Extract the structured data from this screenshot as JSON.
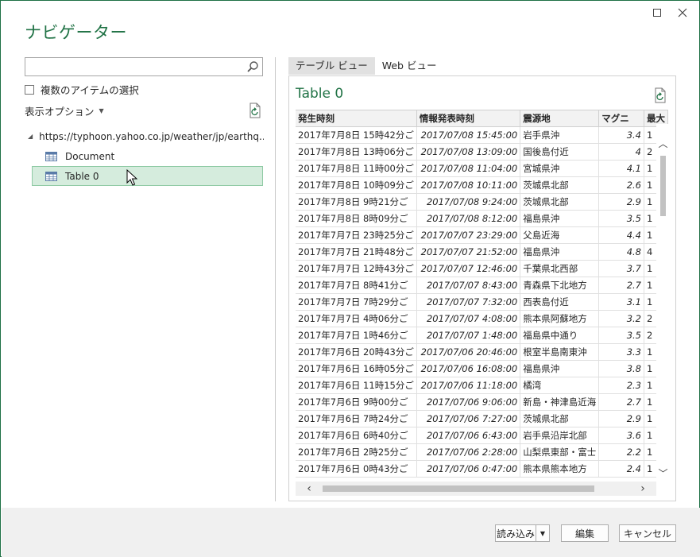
{
  "window": {
    "title": "ナビゲーター",
    "controls": [
      "maximize",
      "close"
    ]
  },
  "left_pane": {
    "search": {
      "value": "",
      "placeholder": ""
    },
    "multi_select_label": "複数のアイテムの選択",
    "display_options_label": "表示オプション",
    "tree": {
      "root_label": "https://typhoon.yahoo.co.jp/weather/jp/earthq...",
      "items": [
        {
          "label": "Document",
          "selected": false
        },
        {
          "label": "Table 0",
          "selected": true
        }
      ]
    }
  },
  "right_pane": {
    "tabs": [
      {
        "label": "テーブル ビュー",
        "active": true
      },
      {
        "label": "Web ビュー",
        "active": false
      }
    ],
    "preview_title": "Table 0",
    "columns": [
      "発生時刻",
      "情報発表時刻",
      "震源地",
      "マグニ",
      "最大"
    ],
    "rows": [
      [
        "2017年7月8日 15時42分ご",
        "2017/07/08 15:45:00",
        "岩手県沖",
        "3.4",
        "1"
      ],
      [
        "2017年7月8日 13時06分ご",
        "2017/07/08 13:09:00",
        "国後島付近",
        "4",
        "2"
      ],
      [
        "2017年7月8日 11時00分ご",
        "2017/07/08 11:04:00",
        "宮城県沖",
        "4.1",
        "1"
      ],
      [
        "2017年7月8日 10時09分ご",
        "2017/07/08 10:11:00",
        "茨城県北部",
        "2.6",
        "1"
      ],
      [
        "2017年7月8日 9時21分ご",
        "2017/07/08 9:24:00",
        "茨城県北部",
        "2.9",
        "1"
      ],
      [
        "2017年7月8日 8時09分ご",
        "2017/07/08 8:12:00",
        "福島県沖",
        "3.5",
        "1"
      ],
      [
        "2017年7月7日 23時25分ご",
        "2017/07/07 23:29:00",
        "父島近海",
        "4.4",
        "1"
      ],
      [
        "2017年7月7日 21時48分ご",
        "2017/07/07 21:52:00",
        "福島県沖",
        "4.8",
        "4"
      ],
      [
        "2017年7月7日 12時43分ご",
        "2017/07/07 12:46:00",
        "千葉県北西部",
        "3.7",
        "1"
      ],
      [
        "2017年7月7日 8時41分ご",
        "2017/07/07 8:43:00",
        "青森県下北地方",
        "2.7",
        "1"
      ],
      [
        "2017年7月7日 7時29分ご",
        "2017/07/07 7:32:00",
        "西表島付近",
        "3.1",
        "1"
      ],
      [
        "2017年7月7日 4時06分ご",
        "2017/07/07 4:08:00",
        "熊本県阿蘇地方",
        "3.2",
        "2"
      ],
      [
        "2017年7月7日 1時46分ご",
        "2017/07/07 1:48:00",
        "福島県中通り",
        "3.5",
        "2"
      ],
      [
        "2017年7月6日 20時43分ご",
        "2017/07/06 20:46:00",
        "根室半島南東沖",
        "3.3",
        "1"
      ],
      [
        "2017年7月6日 16時05分ご",
        "2017/07/06 16:08:00",
        "福島県沖",
        "3.8",
        "1"
      ],
      [
        "2017年7月6日 11時15分ご",
        "2017/07/06 11:18:00",
        "橘湾",
        "2.3",
        "1"
      ],
      [
        "2017年7月6日 9時00分ご",
        "2017/07/06 9:06:00",
        "新島・神津島近海",
        "2.7",
        "1"
      ],
      [
        "2017年7月6日 7時24分ご",
        "2017/07/06 7:27:00",
        "茨城県北部",
        "2.9",
        "1"
      ],
      [
        "2017年7月6日 6時40分ご",
        "2017/07/06 6:43:00",
        "岩手県沿岸北部",
        "3.6",
        "1"
      ],
      [
        "2017年7月6日 2時25分ご",
        "2017/07/06 2:28:00",
        "山梨県東部・富士",
        "2.2",
        "1"
      ],
      [
        "2017年7月6日 0時43分ご",
        "2017/07/06 0:47:00",
        "熊本県熊本地方",
        "2.4",
        "1"
      ]
    ]
  },
  "footer": {
    "load_label": "読み込み",
    "edit_label": "編集",
    "cancel_label": "キャンセル"
  },
  "colors": {
    "accent": "#217346",
    "selection_bg": "#d5ecdd",
    "footer_bg": "#f0f0f0"
  }
}
